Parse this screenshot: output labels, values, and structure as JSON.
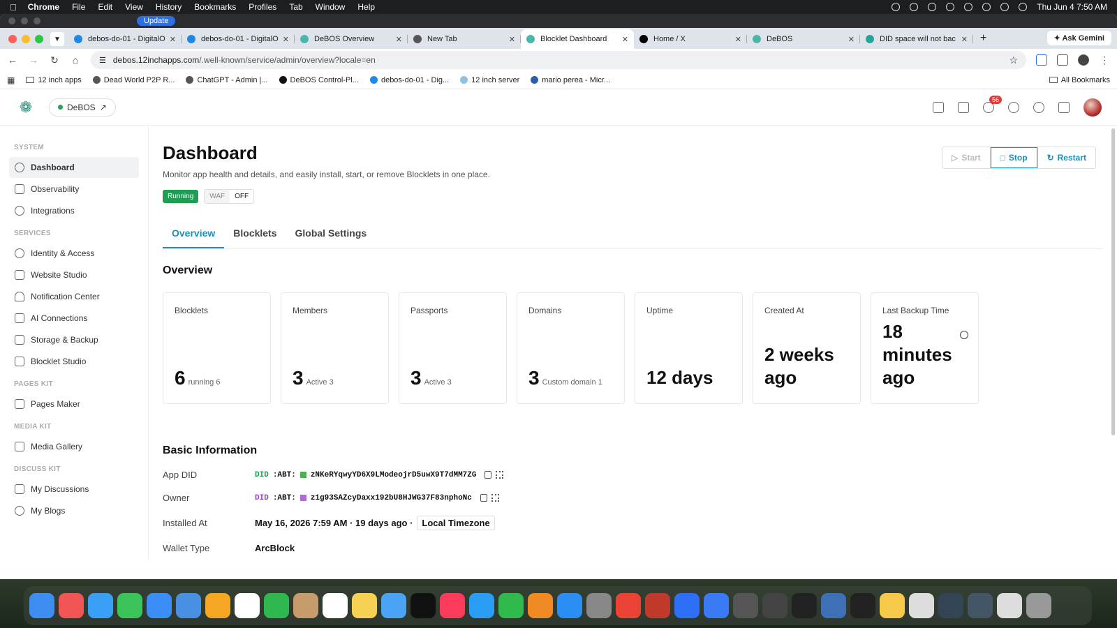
{
  "menubar": {
    "app": "Chrome",
    "items": [
      "File",
      "Edit",
      "View",
      "History",
      "Bookmarks",
      "Profiles",
      "Tab",
      "Window",
      "Help"
    ],
    "datetime": "Thu Jun 4  7:50 AM"
  },
  "titlebar": {
    "update": "Update"
  },
  "tabs": [
    {
      "title": "debos-do-01 - DigitalO",
      "color": "#1e88e5"
    },
    {
      "title": "debos-do-01 - DigitalO",
      "color": "#1e88e5"
    },
    {
      "title": "DeBOS Overview",
      "color": "#4db6ac"
    },
    {
      "title": "New Tab",
      "color": "#555555"
    },
    {
      "title": "Blocklet Dashboard",
      "color": "#4db6ac",
      "active": true
    },
    {
      "title": "Home / X",
      "color": "#000000"
    },
    {
      "title": "DeBOS",
      "color": "#4db6ac"
    },
    {
      "title": "DID space will not bac",
      "color": "#26a69a"
    }
  ],
  "ask_gemini": "Ask Gemini",
  "address": {
    "host": "debos.12inchapps.com",
    "path": "/.well-known/service/admin/overview?locale=en"
  },
  "bookmarks": [
    "12 inch apps",
    "Dead World P2P R...",
    "ChatGPT - Admin |...",
    "DeBOS Control-Pl...",
    "debos-do-01 - Dig...",
    "12 inch server",
    "mario perea - Micr..."
  ],
  "all_bookmarks": "All Bookmarks",
  "header": {
    "app_name": "DeBOS",
    "notifications": "56"
  },
  "sidebar": {
    "sections": [
      {
        "title": "SYSTEM",
        "items": [
          "Dashboard",
          "Observability",
          "Integrations"
        ]
      },
      {
        "title": "SERVICES",
        "items": [
          "Identity & Access",
          "Website Studio",
          "Notification Center",
          "AI Connections",
          "Storage & Backup",
          "Blocklet Studio"
        ]
      },
      {
        "title": "PAGES KIT",
        "items": [
          "Pages Maker"
        ]
      },
      {
        "title": "MEDIA KIT",
        "items": [
          "Media Gallery"
        ]
      },
      {
        "title": "DISCUSS KIT",
        "items": [
          "My Discussions",
          "My Blogs"
        ]
      }
    ]
  },
  "page": {
    "title": "Dashboard",
    "description": "Monitor app health and details, and easily install, start, or remove Blocklets in one place.",
    "status": "Running",
    "waf_label": "WAF",
    "waf_value": "OFF",
    "actions": {
      "start": "Start",
      "stop": "Stop",
      "restart": "Restart"
    },
    "tabs": [
      "Overview",
      "Blocklets",
      "Global Settings"
    ],
    "overview_title": "Overview",
    "cards": [
      {
        "label": "Blocklets",
        "value": "6",
        "sub": "running 6"
      },
      {
        "label": "Members",
        "value": "3",
        "sub": "Active 3"
      },
      {
        "label": "Passports",
        "value": "3",
        "sub": "Active 3"
      },
      {
        "label": "Domains",
        "value": "3",
        "sub": "Custom domain 1"
      },
      {
        "label": "Uptime",
        "big": "12 days"
      },
      {
        "label": "Created At",
        "big": "2 weeks ago"
      },
      {
        "label": "Last Backup Time",
        "big": "18 minutes ago"
      }
    ],
    "basic_title": "Basic Information",
    "basic": {
      "app_did_label": "App DID",
      "app_did_prefix": "DID",
      "app_did_abt": ":ABT:",
      "app_did_value": "zNKeRYqwyYD6X9LModeojrD5uwX9T7dMM7ZG",
      "owner_label": "Owner",
      "owner_prefix": "DID",
      "owner_abt": ":ABT:",
      "owner_value": "z1g93SAZcyDaxx192bU8HJWG37F83nphoNc",
      "installed_label": "Installed At",
      "installed_value": "May 16, 2026 7:59 AM · 19 days ago ·",
      "timezone": "Local Timezone",
      "wallet_label": "Wallet Type",
      "wallet_value": "ArcBlock"
    }
  },
  "dock_colors": [
    "#3d8ef0",
    "#f25555",
    "#3aa0f5",
    "#3cc35a",
    "#3a8ef5",
    "#4a90e2",
    "#f5a623",
    "#ffffff",
    "#2fb84f",
    "#c69c6d",
    "#ffffff",
    "#f7d154",
    "#4aa3f5",
    "#111111",
    "#fa3c5a",
    "#2a9df4",
    "#30b94d",
    "#f08a24",
    "#2b8ef5",
    "#888888",
    "#ea4335",
    "#c0392b",
    "#2d6ff7",
    "#3a7af5",
    "#555555",
    "#444444",
    "#222222",
    "#3f6fb5",
    "#222222",
    "#f7c948",
    "#dddddd",
    "#334455",
    "#445566",
    "#dddddd",
    "#999999"
  ]
}
